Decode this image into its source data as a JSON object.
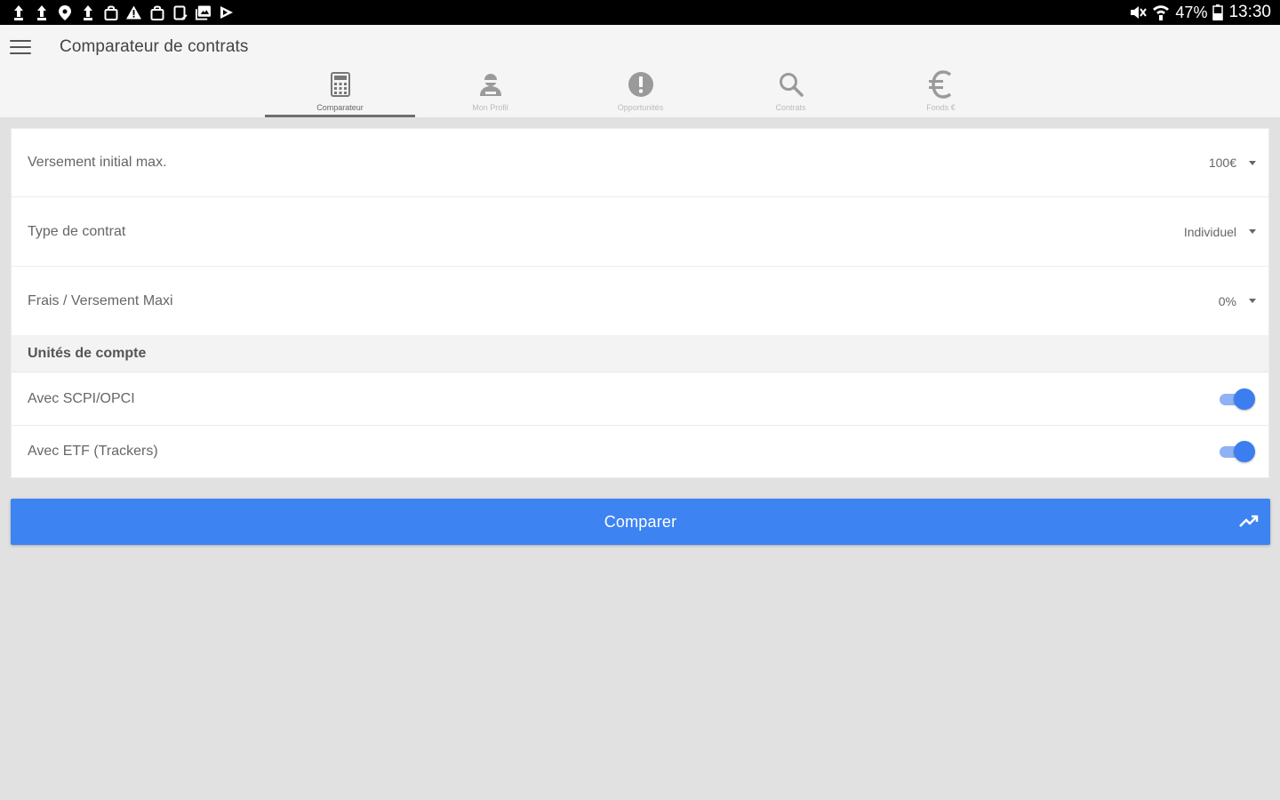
{
  "status_bar": {
    "battery": "47%",
    "time": "13:30",
    "left_icons": [
      "upload-icon",
      "upload-icon",
      "location-pin-icon",
      "upload-icon",
      "shopping-bag-icon",
      "warning-icon",
      "shopping-bag-icon",
      "tablet-icon",
      "photo-icon",
      "play-store-icon"
    ],
    "right_icons": [
      "mute-icon",
      "wifi-icon",
      "battery-icon"
    ]
  },
  "header": {
    "title": "Comparateur de contrats"
  },
  "tabs": [
    {
      "label": "Comparateur",
      "icon": "calculator-icon",
      "active": true
    },
    {
      "label": "Mon Profil",
      "icon": "person-icon",
      "active": false
    },
    {
      "label": "Opportunités",
      "icon": "alert-circle-icon",
      "active": false
    },
    {
      "label": "Contrats",
      "icon": "search-icon",
      "active": false
    },
    {
      "label": "Fonds €",
      "icon": "euro-icon",
      "active": false
    }
  ],
  "form": {
    "fields": [
      {
        "label": "Versement initial max.",
        "value": "100€"
      },
      {
        "label": "Type de contrat",
        "value": "Individuel"
      },
      {
        "label": "Frais / Versement Maxi",
        "value": "0%"
      }
    ],
    "section_title": "Unités de compte",
    "toggles": [
      {
        "label": "Avec SCPI/OPCI",
        "checked": true
      },
      {
        "label": "Avec ETF (Trackers)",
        "checked": true
      }
    ]
  },
  "compare_button": {
    "label": "Comparer",
    "icon": "trending-up-icon"
  },
  "colors": {
    "accent": "#3d83f2",
    "toggle_track": "#8fb1f5",
    "background": "#e1e1e1",
    "appbar": "#f5f5f5"
  }
}
